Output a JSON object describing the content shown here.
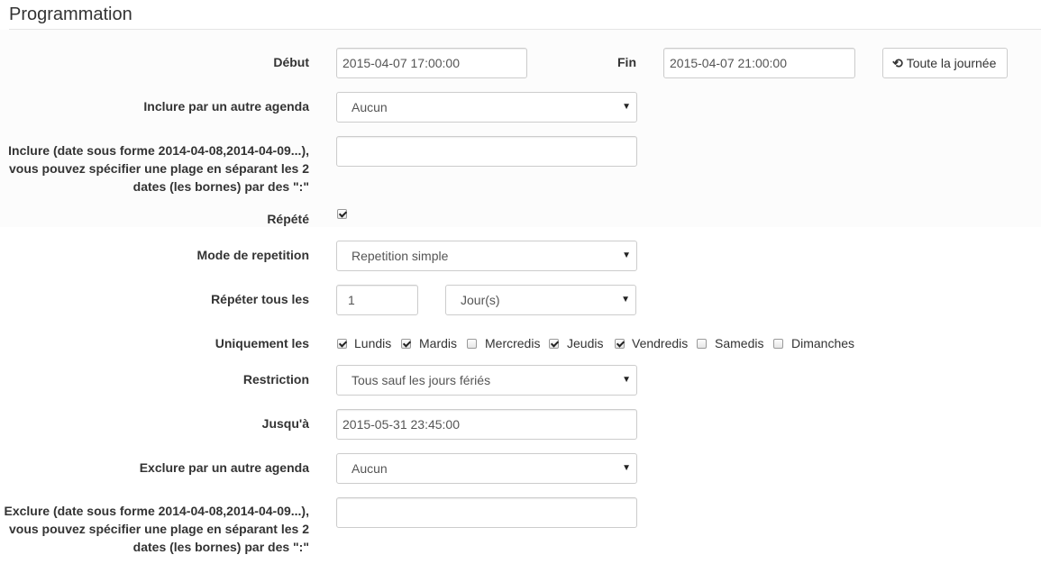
{
  "page": {
    "title": "Programmation"
  },
  "debut": {
    "label": "Début",
    "value": "2015-04-07 17:00:00"
  },
  "fin": {
    "label": "Fin",
    "value": "2015-04-07 21:00:00"
  },
  "allday": {
    "label": "Toute la journée",
    "icon": "history-icon"
  },
  "inclure_agenda": {
    "label": "Inclure par un autre agenda",
    "value": "Aucun"
  },
  "inclure_dates": {
    "label_lines": [
      "Inclure (date sous forme 2014-04-08,2014-04-09...),",
      "vous pouvez spécifier une plage en séparant les 2",
      "dates (les bornes) par des \":\""
    ],
    "value": ""
  },
  "repete": {
    "label": "Répété",
    "checked": true
  },
  "mode": {
    "label": "Mode de repetition",
    "value": "Repetition simple"
  },
  "repeter": {
    "label": "Répéter tous les",
    "value": "1",
    "unit": "Jour(s)"
  },
  "uniquement": {
    "label": "Uniquement les",
    "days": [
      {
        "label": "Lundis",
        "checked": true
      },
      {
        "label": "Mardis",
        "checked": true
      },
      {
        "label": "Mercredis",
        "checked": false
      },
      {
        "label": "Jeudis",
        "checked": true
      },
      {
        "label": "Vendredis",
        "checked": true
      },
      {
        "label": "Samedis",
        "checked": false
      },
      {
        "label": "Dimanches",
        "checked": false
      }
    ]
  },
  "restriction": {
    "label": "Restriction",
    "value": "Tous sauf les jours fériés"
  },
  "jusqua": {
    "label": "Jusqu'à",
    "value": "2015-05-31 23:45:00"
  },
  "exclure_agenda": {
    "label": "Exclure par un autre agenda",
    "value": "Aucun"
  },
  "exclure_dates": {
    "label_lines": [
      "Exclure (date sous forme 2014-04-08,2014-04-09...),",
      "vous pouvez spécifier une plage en séparant les 2",
      "dates (les bornes) par des \":\""
    ],
    "value": ""
  },
  "caret_glyph": "▼"
}
